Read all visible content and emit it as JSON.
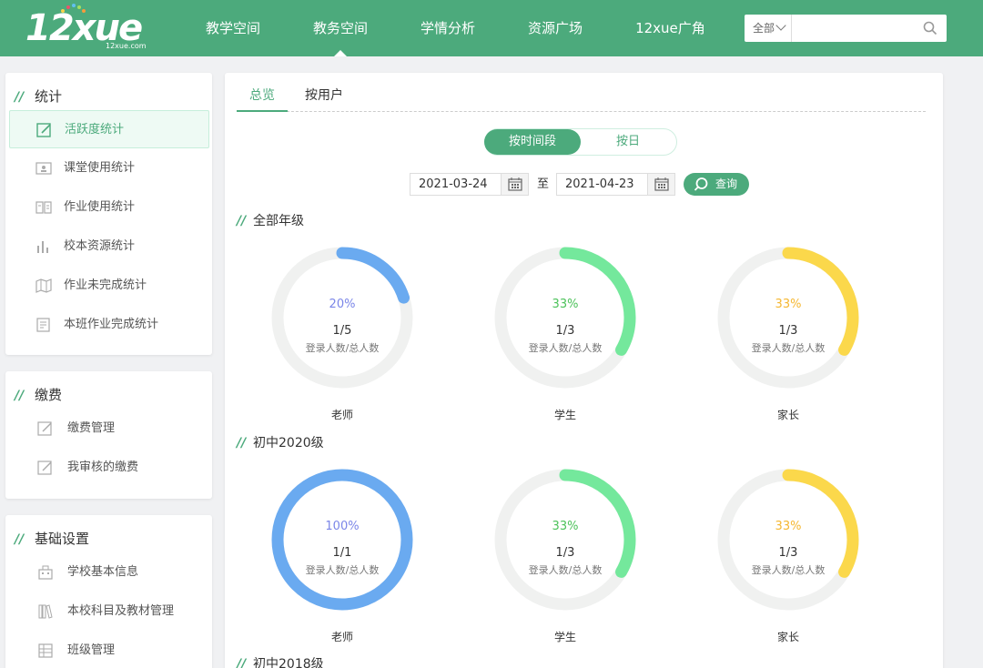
{
  "header": {
    "logo_text": "12xue",
    "logo_sub": "12xue.com",
    "nav": [
      "教学空间",
      "教务空间",
      "学情分析",
      "资源广场",
      "12xue广角"
    ],
    "active_nav": 1,
    "search": {
      "scope": "全部",
      "placeholder": ""
    }
  },
  "sidebar": {
    "stats": {
      "title": "统计",
      "items": [
        {
          "label": "活跃度统计",
          "icon": "edit-icon"
        },
        {
          "label": "课堂使用统计",
          "icon": "classroom-icon"
        },
        {
          "label": "作业使用统计",
          "icon": "book-icon"
        },
        {
          "label": "校本资源统计",
          "icon": "bar-chart-icon"
        },
        {
          "label": "作业未完成统计",
          "icon": "map-icon"
        },
        {
          "label": "本班作业完成统计",
          "icon": "document-icon"
        }
      ]
    },
    "payment": {
      "title": "缴费",
      "items": [
        {
          "label": "缴费管理",
          "icon": "edit-icon"
        },
        {
          "label": "我审核的缴费",
          "icon": "edit-icon"
        }
      ]
    },
    "settings": {
      "title": "基础设置",
      "items": [
        {
          "label": "学校基本信息",
          "icon": "building-icon"
        },
        {
          "label": "本校科目及教材管理",
          "icon": "books-icon"
        },
        {
          "label": "班级管理",
          "icon": "grid-icon"
        }
      ]
    }
  },
  "main": {
    "tabs": [
      "总览",
      "按用户"
    ],
    "mode": {
      "by_period": "按时间段",
      "by_day": "按日"
    },
    "date_from": "2021-03-24",
    "date_sep": "至",
    "date_to": "2021-04-23",
    "query_label": "查询",
    "sections": [
      {
        "title": "全部年级",
        "charts": [
          {
            "role": "老师",
            "percent": "20%",
            "ratio": "1/5",
            "caption": "登录人数/总人数",
            "value": 0.2,
            "color": "#6aaaf0"
          },
          {
            "role": "学生",
            "percent": "33%",
            "ratio": "1/3",
            "caption": "登录人数/总人数",
            "value": 0.333,
            "color": "#74e89c"
          },
          {
            "role": "家长",
            "percent": "33%",
            "ratio": "1/3",
            "caption": "登录人数/总人数",
            "value": 0.333,
            "color": "#fbd84b"
          }
        ]
      },
      {
        "title": "初中2020级",
        "charts": [
          {
            "role": "老师",
            "percent": "100%",
            "ratio": "1/1",
            "caption": "登录人数/总人数",
            "value": 1.0,
            "color": "#6aaaf0"
          },
          {
            "role": "学生",
            "percent": "33%",
            "ratio": "1/3",
            "caption": "登录人数/总人数",
            "value": 0.333,
            "color": "#74e89c"
          },
          {
            "role": "家长",
            "percent": "33%",
            "ratio": "1/3",
            "caption": "登录人数/总人数",
            "value": 0.333,
            "color": "#fbd84b"
          }
        ]
      },
      {
        "title": "初中2018级",
        "charts": []
      }
    ]
  },
  "colors": {
    "brand": "#4caa7c",
    "teacher": "#6aaaf0",
    "student": "#74e89c",
    "parent": "#fbd84b",
    "teacher_text": "#7b86e8",
    "student_text": "#4cc25a",
    "parent_text": "#f5b731",
    "track": "#f0f1f0"
  }
}
